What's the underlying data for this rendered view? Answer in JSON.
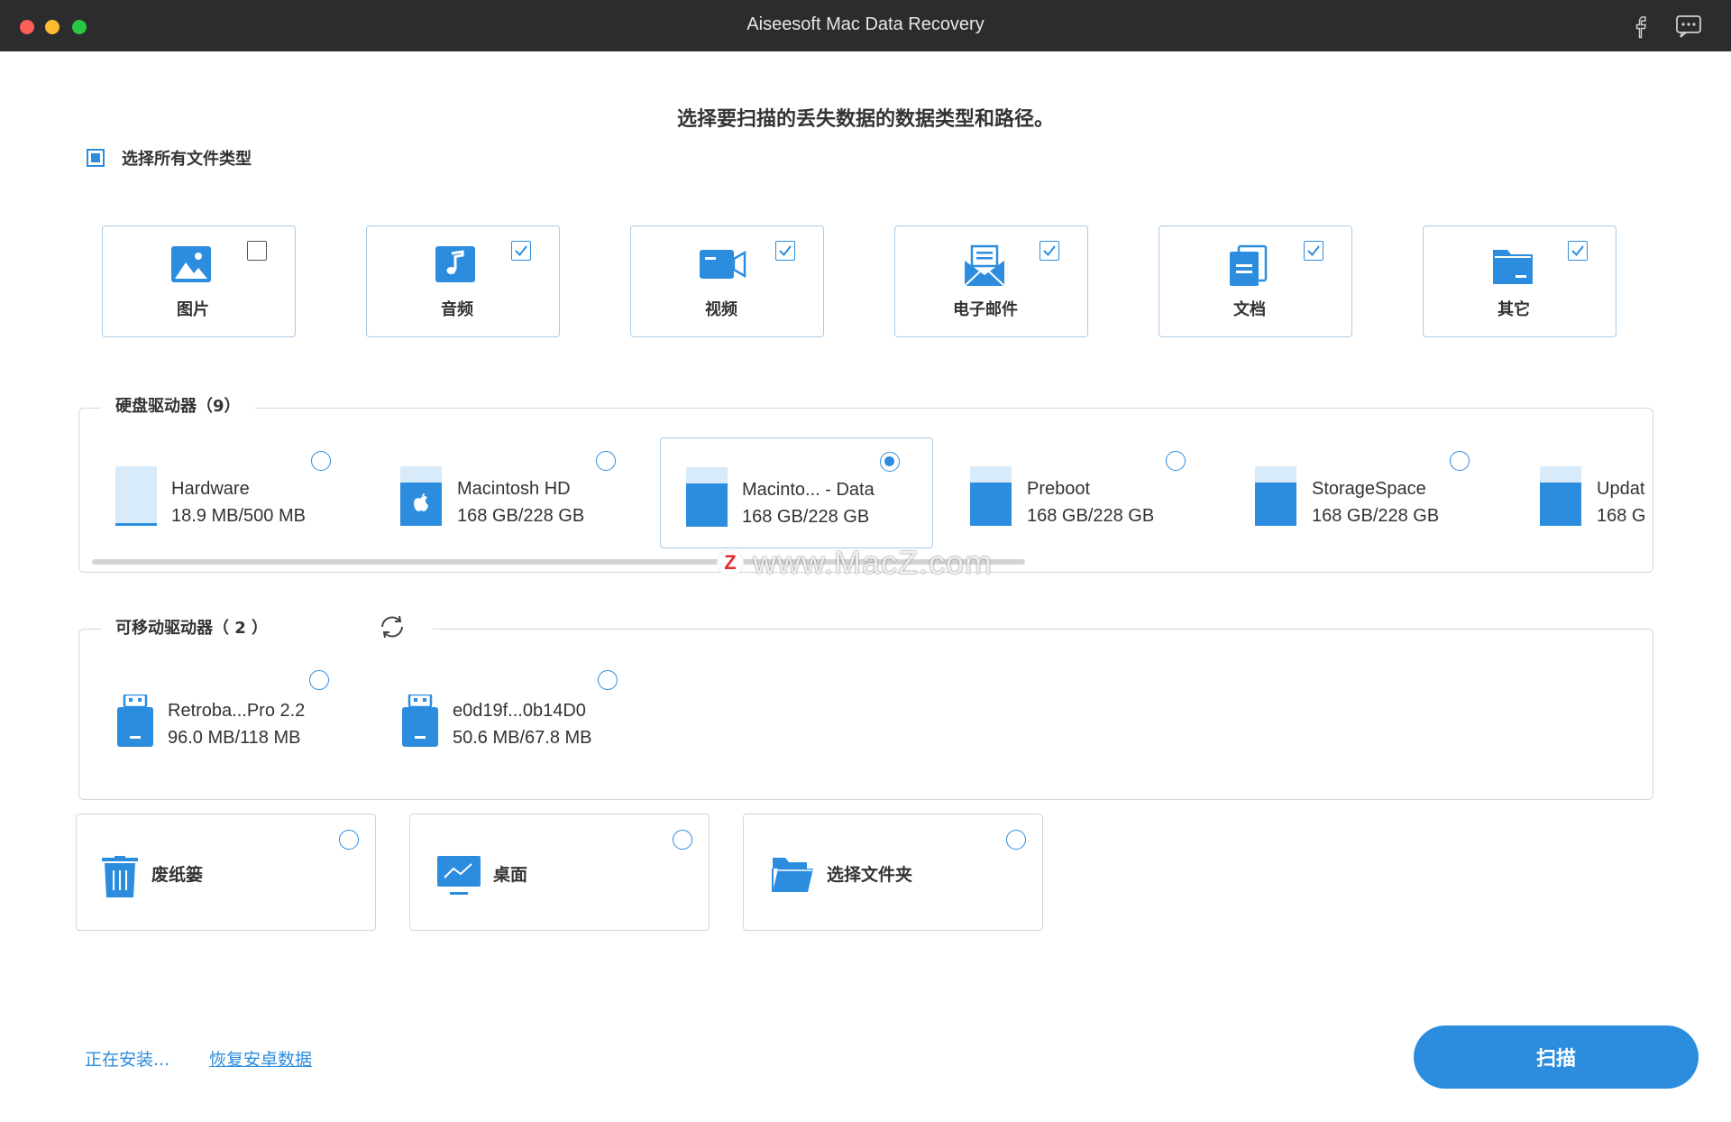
{
  "window": {
    "title": "Aiseesoft Mac Data Recovery"
  },
  "header": {
    "main_title": "选择要扫描的丢失数据的数据类型和路径。",
    "select_all_label": "选择所有文件类型"
  },
  "file_types": [
    {
      "label": "图片",
      "checked": false,
      "icon": "image-icon"
    },
    {
      "label": "音频",
      "checked": true,
      "icon": "music-icon"
    },
    {
      "label": "视频",
      "checked": true,
      "icon": "video-icon"
    },
    {
      "label": "电子邮件",
      "checked": true,
      "icon": "email-icon"
    },
    {
      "label": "文档",
      "checked": true,
      "icon": "document-icon"
    },
    {
      "label": "其它",
      "checked": true,
      "icon": "folder-icon"
    }
  ],
  "hard_drives": {
    "title": "硬盘驱动器（9）",
    "items": [
      {
        "name": "Hardware",
        "size": "18.9 MB/500 MB",
        "selected": false
      },
      {
        "name": "Macintosh HD",
        "size": "168 GB/228 GB",
        "selected": false
      },
      {
        "name": "Macinto... - Data",
        "size": "168 GB/228 GB",
        "selected": true
      },
      {
        "name": "Preboot",
        "size": "168 GB/228 GB",
        "selected": false
      },
      {
        "name": "StorageSpace",
        "size": "168 GB/228 GB",
        "selected": false
      },
      {
        "name": "Updat",
        "size": "168 G",
        "selected": false
      }
    ]
  },
  "removable_drives": {
    "title": "可移动驱动器（ 2 ）",
    "items": [
      {
        "name": "Retroba...Pro 2.2",
        "size": "96.0 MB/118 MB"
      },
      {
        "name": "e0d19f...0b14D0",
        "size": "50.6 MB/67.8 MB"
      }
    ]
  },
  "locations": [
    {
      "label": "废纸篓",
      "icon": "trash-icon"
    },
    {
      "label": "桌面",
      "icon": "desktop-icon"
    },
    {
      "label": "选择文件夹",
      "icon": "open-folder-icon"
    }
  ],
  "watermark": {
    "badge": "Z",
    "text": "www.MacZ.com"
  },
  "footer": {
    "installing_label": "正在安装...",
    "android_link": "恢复安卓数据",
    "scan_label": "扫描"
  },
  "colors": {
    "accent": "#2c8ddf",
    "titlebar": "#2c2c2e",
    "card_border": "#a9cbe8"
  }
}
